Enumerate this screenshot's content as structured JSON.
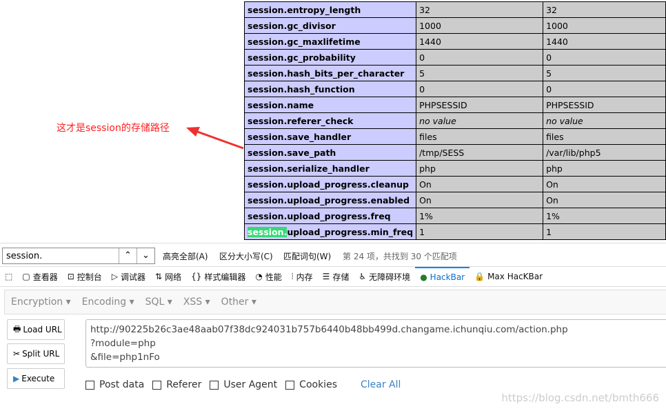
{
  "table": {
    "rows": [
      {
        "key": "session.entropy_length",
        "local": "32",
        "master": "32"
      },
      {
        "key": "session.gc_divisor",
        "local": "1000",
        "master": "1000"
      },
      {
        "key": "session.gc_maxlifetime",
        "local": "1440",
        "master": "1440"
      },
      {
        "key": "session.gc_probability",
        "local": "0",
        "master": "0"
      },
      {
        "key": "session.hash_bits_per_character",
        "local": "5",
        "master": "5"
      },
      {
        "key": "session.hash_function",
        "local": "0",
        "master": "0"
      },
      {
        "key": "session.name",
        "local": "PHPSESSID",
        "master": "PHPSESSID"
      },
      {
        "key": "session.referer_check",
        "local": "no value",
        "master": "no value"
      },
      {
        "key": "session.save_handler",
        "local": "files",
        "master": "files"
      },
      {
        "key": "session.save_path",
        "local": "/tmp/SESS",
        "master": "/var/lib/php5"
      },
      {
        "key": "session.serialize_handler",
        "local": "php",
        "master": "php"
      },
      {
        "key": "session.upload_progress.cleanup",
        "local": "On",
        "master": "On"
      },
      {
        "key": "session.upload_progress.enabled",
        "local": "On",
        "master": "On"
      },
      {
        "key": "session.upload_progress.freq",
        "local": "1%",
        "master": "1%"
      },
      {
        "key": "session.upload_progress.min_freq",
        "local": "1",
        "master": "1"
      }
    ],
    "highlight_term": "session."
  },
  "annotation": "这才是session的存储路径",
  "find": {
    "value": "session.",
    "highlight_all": "高亮全部(A)",
    "match_case": "区分大小写(C)",
    "whole_words": "匹配词句(W)",
    "status": "第 24 项，共找到 30 个匹配项"
  },
  "devtools": {
    "tabs": [
      "查看器",
      "控制台",
      "调试器",
      "网络",
      "样式编辑器",
      "性能",
      "内存",
      "存储",
      "无障碍环境",
      "HackBar",
      "Max HacKBar"
    ],
    "active": "HackBar"
  },
  "hackbar": {
    "menus": [
      "Encryption",
      "Encoding",
      "SQL",
      "XSS",
      "Other"
    ],
    "load_url": "Load URL",
    "split_url": "Split URL",
    "execute": "Execute",
    "url_lines": [
      "http://90225b26c3ae48aab07f38dc924031b757b6440b48bb499d.changame.ichunqiu.com/action.php",
      "?module=php",
      "&file=php1nFo"
    ],
    "checkboxes": [
      "Post data",
      "Referer",
      "User Agent",
      "Cookies"
    ],
    "clear_all": "Clear All"
  },
  "watermark": "https://blog.csdn.net/bmth666"
}
